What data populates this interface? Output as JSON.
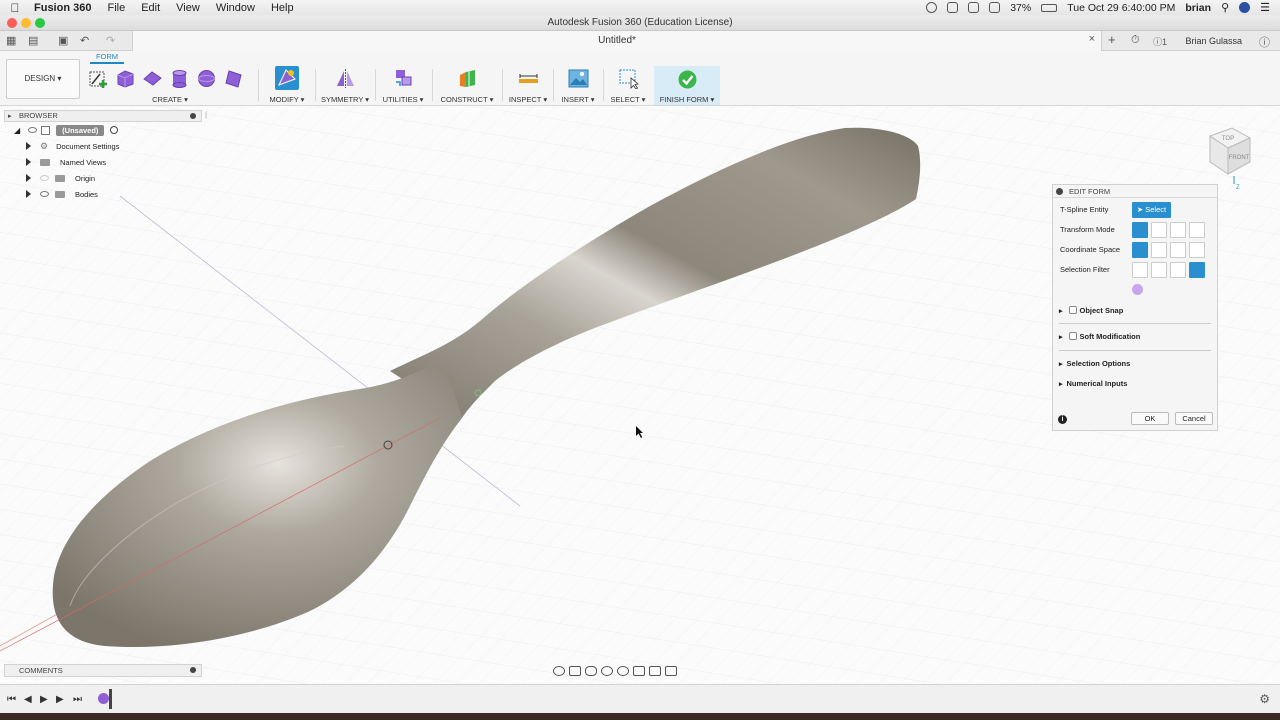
{
  "menubar": {
    "app_name": "Fusion 360",
    "menus": [
      "File",
      "Edit",
      "View",
      "Window",
      "Help"
    ],
    "battery": "37%",
    "datetime": "Tue Oct 29  6:40:00 PM",
    "user": "brian"
  },
  "window": {
    "title": "Autodesk Fusion 360 (Education License)"
  },
  "tabbar": {
    "doc_title": "Untitled*",
    "notifications": "1",
    "user_name": "Brian Gulassa"
  },
  "ribbon": {
    "workspace": "DESIGN",
    "active_tab": "FORM",
    "groups": {
      "create": "CREATE",
      "modify": "MODIFY",
      "symmetry": "SYMMETRY",
      "utilities": "UTILITIES",
      "construct": "CONSTRUCT",
      "inspect": "INSPECT",
      "insert": "INSERT",
      "select": "SELECT",
      "finish": "FINISH FORM"
    }
  },
  "browser": {
    "title": "BROWSER",
    "root": "(Unsaved)",
    "items": [
      "Document Settings",
      "Named Views",
      "Origin",
      "Bodies"
    ]
  },
  "viewcube": {
    "top": "TOP",
    "front": "FRONT"
  },
  "edit_form": {
    "title": "EDIT FORM",
    "rows": {
      "tspline_entity": "T-Spline Entity",
      "select_label": "Select",
      "transform_mode": "Transform Mode",
      "coordinate_space": "Coordinate Space",
      "selection_filter": "Selection Filter"
    },
    "object_snap": "Object Snap",
    "soft_modification": "Soft Modification",
    "selection_options": "Selection Options",
    "numerical_inputs": "Numerical Inputs",
    "ok": "OK",
    "cancel": "Cancel"
  },
  "comments": {
    "title": "COMMENTS"
  },
  "colors": {
    "accent": "#2a8fcf",
    "finish_green": "#3cb54a",
    "tool_purple": "#8e5fd6",
    "spoon_metal": "#9c968a"
  }
}
